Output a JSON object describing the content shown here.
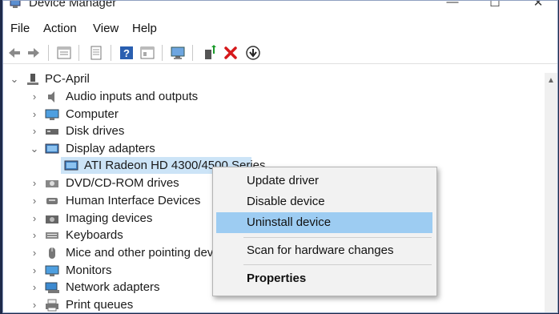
{
  "window": {
    "title": "Device Manager",
    "controls": {
      "minimize": "—",
      "maximize": "☐",
      "close": "✕"
    }
  },
  "menu": [
    "File",
    "Action",
    "View",
    "Help"
  ],
  "toolbar": {
    "icons": [
      "back-icon",
      "forward-icon",
      "properties-icon",
      "show-hidden-icon",
      "help-icon",
      "view-icon",
      "monitor-scan-icon",
      "update-driver-icon",
      "uninstall-icon",
      "download-icon"
    ],
    "colors": {
      "uninstall": "#d6191b",
      "help": "#2a5fb0"
    }
  },
  "tree": {
    "root": "PC-April",
    "items": [
      {
        "label": "Audio inputs and outputs",
        "icon": "speaker-icon",
        "expanded": false
      },
      {
        "label": "Computer",
        "icon": "computer-icon",
        "expanded": false
      },
      {
        "label": "Disk drives",
        "icon": "disk-icon",
        "expanded": false
      },
      {
        "label": "Display adapters",
        "icon": "display-adapter-icon",
        "expanded": true
      },
      {
        "label": "ATI Radeon HD 4300/4500 Series",
        "icon": "display-adapter-icon",
        "child": true,
        "selected": true
      },
      {
        "label": "DVD/CD-ROM drives",
        "icon": "dvd-icon",
        "expanded": false
      },
      {
        "label": "Human Interface Devices",
        "icon": "hid-icon",
        "expanded": false
      },
      {
        "label": "Imaging devices",
        "icon": "camera-icon",
        "expanded": false
      },
      {
        "label": "Keyboards",
        "icon": "keyboard-icon",
        "expanded": false
      },
      {
        "label": "Mice and other pointing devi",
        "icon": "mouse-icon",
        "expanded": false
      },
      {
        "label": "Monitors",
        "icon": "monitor-icon",
        "expanded": false
      },
      {
        "label": "Network adapters",
        "icon": "network-icon",
        "expanded": false
      },
      {
        "label": "Print queues",
        "icon": "printer-icon",
        "expanded": false
      }
    ]
  },
  "context_menu": {
    "items": [
      {
        "label": "Update driver",
        "highlighted": false,
        "bold": false
      },
      {
        "label": "Disable device",
        "highlighted": false,
        "bold": false
      },
      {
        "label": "Uninstall device",
        "highlighted": true,
        "bold": false
      },
      {
        "label": "Scan for hardware changes",
        "highlighted": false,
        "bold": false
      },
      {
        "label": "Properties",
        "highlighted": false,
        "bold": true
      }
    ]
  },
  "colors": {
    "selection": "#cce4f7",
    "menu_highlight": "#9dccf2",
    "frame": "#1e2a4a"
  }
}
